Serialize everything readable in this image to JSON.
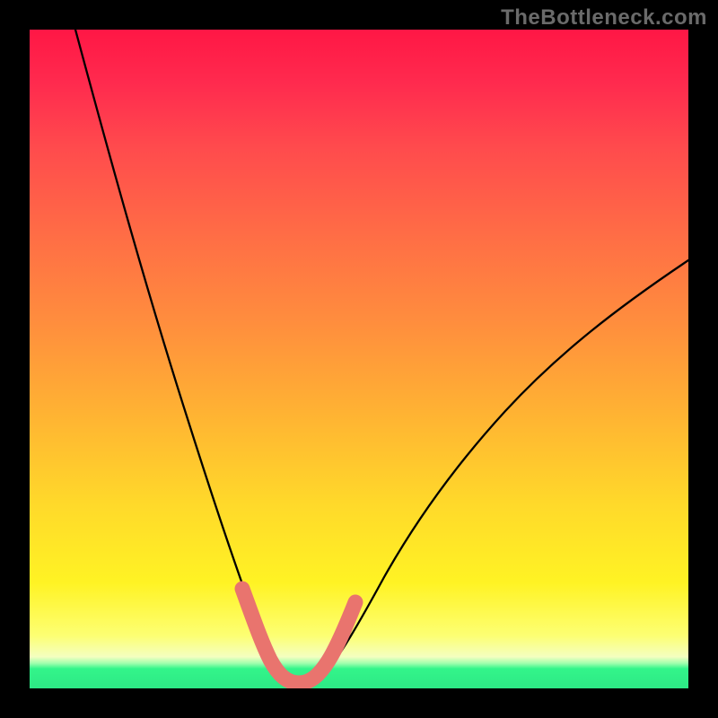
{
  "watermark": "TheBottleneck.com",
  "chart_data": {
    "type": "line",
    "title": "",
    "xlabel": "",
    "ylabel": "",
    "xlim": [
      0,
      100
    ],
    "ylim": [
      0,
      100
    ],
    "series": [
      {
        "name": "main-curve",
        "color": "#000000",
        "points": [
          {
            "x": 7,
            "y": 100
          },
          {
            "x": 12,
            "y": 80
          },
          {
            "x": 18,
            "y": 60
          },
          {
            "x": 24,
            "y": 40
          },
          {
            "x": 28,
            "y": 25
          },
          {
            "x": 31,
            "y": 14
          },
          {
            "x": 34,
            "y": 6
          },
          {
            "x": 36,
            "y": 2
          },
          {
            "x": 38,
            "y": 0.5
          },
          {
            "x": 41,
            "y": 0.5
          },
          {
            "x": 43,
            "y": 1.5
          },
          {
            "x": 46,
            "y": 4
          },
          {
            "x": 50,
            "y": 10
          },
          {
            "x": 56,
            "y": 20
          },
          {
            "x": 63,
            "y": 31
          },
          {
            "x": 72,
            "y": 43
          },
          {
            "x": 82,
            "y": 54
          },
          {
            "x": 92,
            "y": 62
          },
          {
            "x": 100,
            "y": 67
          }
        ]
      },
      {
        "name": "highlight-segment",
        "color": "#e9746e",
        "points": [
          {
            "x": 32,
            "y": 10
          },
          {
            "x": 34,
            "y": 5
          },
          {
            "x": 36,
            "y": 2
          },
          {
            "x": 38,
            "y": 0.7
          },
          {
            "x": 41,
            "y": 0.7
          },
          {
            "x": 43,
            "y": 1.5
          },
          {
            "x": 45,
            "y": 4
          },
          {
            "x": 47,
            "y": 7
          },
          {
            "x": 49,
            "y": 11
          }
        ]
      }
    ],
    "notes": "V-shaped curve over rainbow gradient; pink overlay marks the valley region near the minimum."
  }
}
